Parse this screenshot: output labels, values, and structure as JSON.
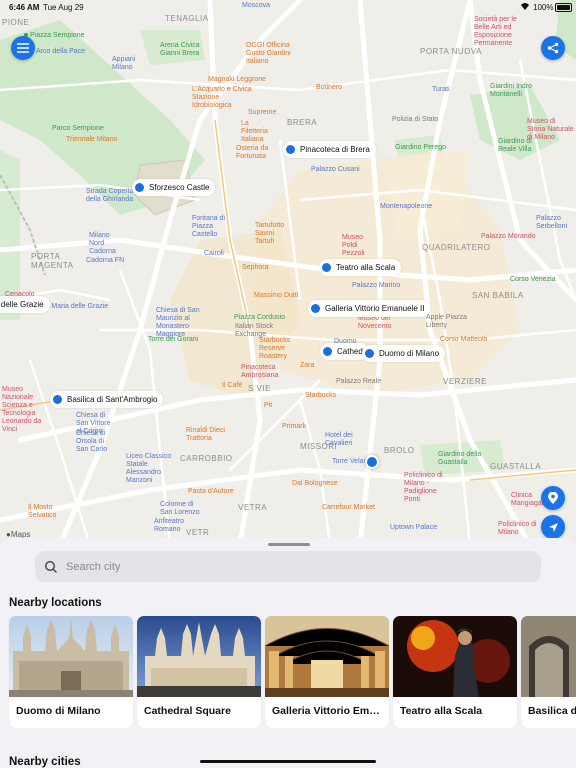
{
  "status_bar": {
    "time": "6:46 AM",
    "date": "Tue Aug 29",
    "battery": "100%"
  },
  "map": {
    "attribution": "Maps",
    "districts": [
      "PIONE",
      "TENAGLIA",
      "PORTA NUOVA",
      "BRERA",
      "PORTA MAGENTA",
      "QUADRILATERO",
      "SAN BABILA",
      "S VIE",
      "VERZIERE",
      "MISSORI",
      "CARROBBIO",
      "BROLO",
      "GUASTALLA",
      "VETRA",
      "VETR"
    ],
    "pois": [
      {
        "text": "Piazza Sempione",
        "color": "green"
      },
      {
        "text": "Arco della Pace",
        "color": "blue"
      },
      {
        "text": "Moscova",
        "color": "blue"
      },
      {
        "text": "Arena Civica Gianni Brera",
        "color": "green"
      },
      {
        "text": "Parco Sempione",
        "color": "green"
      },
      {
        "text": "OGGI Officina Gusto Giardini Italiano",
        "color": "orange"
      },
      {
        "text": "Magnaki Leggrone",
        "color": "orange"
      },
      {
        "text": "L'Acquario e Civica Stazione Idrobiologica",
        "color": "orange"
      },
      {
        "text": "Botinero",
        "color": "orange"
      },
      {
        "text": "Appiani Milano",
        "color": "blue"
      },
      {
        "text": "Triennale Milano",
        "color": "orange"
      },
      {
        "text": "Supreme",
        "color": "orange"
      },
      {
        "text": "La Filetteria Italiana",
        "color": "orange"
      },
      {
        "text": "Osteria da Fortunata",
        "color": "orange"
      },
      {
        "text": "Polizia di Stato",
        "color": "gray"
      },
      {
        "text": "Giardino Perego",
        "color": "green"
      },
      {
        "text": "Palazzo Cusani",
        "color": "blue"
      },
      {
        "text": "Turati",
        "color": "blue"
      },
      {
        "text": "Società per le Belle Arti ed Esposizione Permanente",
        "color": "red"
      },
      {
        "text": "Giardini Indro Montanelli",
        "color": "green"
      },
      {
        "text": "Museo di Storia Naturale di Milano",
        "color": "red"
      },
      {
        "text": "Giardino di Reale Villa",
        "color": "green"
      },
      {
        "text": "Strada Coperta della Ghirlanda",
        "color": "blue"
      },
      {
        "text": "Fontana di Piazza Castello",
        "color": "blue"
      },
      {
        "text": "Tartufotto Savini Tartufi",
        "color": "orange"
      },
      {
        "text": "Museo Poldi Pezzoli",
        "color": "red"
      },
      {
        "text": "Montenapoleone",
        "color": "blue"
      },
      {
        "text": "Palazzo Morando",
        "color": "red"
      },
      {
        "text": "Palazzo Serbelloni",
        "color": "blue"
      },
      {
        "text": "Milano Nord Cadorna",
        "color": "blue"
      },
      {
        "text": "Cadorna FN",
        "color": "blue"
      },
      {
        "text": "Cairoli",
        "color": "blue"
      },
      {
        "text": "Sephora",
        "color": "orange"
      },
      {
        "text": "Massimo Dutti",
        "color": "orange"
      },
      {
        "text": "Palazzo Marino",
        "color": "blue"
      },
      {
        "text": "Corso Venezia",
        "color": "green"
      },
      {
        "text": "Cenacolo",
        "color": "red"
      },
      {
        "text": "Chiesa di San Maurizio al Monastero Maggiore",
        "color": "blue"
      },
      {
        "text": "Piazza Cordusio",
        "color": "green"
      },
      {
        "text": "Italian Stock Exchange",
        "color": "gray"
      },
      {
        "text": "Museo del Novecento",
        "color": "red"
      },
      {
        "text": "Apple Piazza Liberty",
        "color": "gray"
      },
      {
        "text": "Torre dei Gorani",
        "color": "green"
      },
      {
        "text": "Starbucks Reserve Roastery",
        "color": "orange"
      },
      {
        "text": "Duomo",
        "color": "blue"
      },
      {
        "text": "Corso Matteotti",
        "color": "orange"
      },
      {
        "text": "Pinacoteca Ambrosiana",
        "color": "red"
      },
      {
        "text": "Zara",
        "color": "orange"
      },
      {
        "text": "Palazzo Reale",
        "color": "gray"
      },
      {
        "text": "Museo Nazionale Scienza e Tecnologia Leonardo da Vinci",
        "color": "red"
      },
      {
        "text": "Chiesa di San Vittore al Corpo",
        "color": "blue"
      },
      {
        "text": "Chiesa di Santa Maria delle Grazie",
        "color": "blue"
      },
      {
        "text": "Chiesa di Orsola di San Carlo",
        "color": "blue"
      },
      {
        "text": "Il Cafè",
        "color": "orange"
      },
      {
        "text": "Starbucks",
        "color": "orange"
      },
      {
        "text": "Pit",
        "color": "orange"
      },
      {
        "text": "Primark",
        "color": "orange"
      },
      {
        "text": "Rinaldi Dieci Trattoria",
        "color": "orange"
      },
      {
        "text": "Hotel dei Cavalieri",
        "color": "blue"
      },
      {
        "text": "Torre Velasca",
        "color": "blue"
      },
      {
        "text": "Liceo Classico Statale Alessandro Manzoni",
        "color": "blue"
      },
      {
        "text": "Dal Bolognese",
        "color": "orange"
      },
      {
        "text": "Giardino della Guastalla",
        "color": "green"
      },
      {
        "text": "Policlinico di Milano - Padiglione Ponti",
        "color": "red"
      },
      {
        "text": "Clinica Mangiagalli",
        "color": "red"
      },
      {
        "text": "Pasta d'Autore",
        "color": "orange"
      },
      {
        "text": "Colonne di San Lorenzo",
        "color": "blue"
      },
      {
        "text": "Carrefour Market",
        "color": "orange"
      },
      {
        "text": "Anfiteatro Romano",
        "color": "blue"
      },
      {
        "text": "Il Mosto Selvatico",
        "color": "orange"
      },
      {
        "text": "Uptown Palace",
        "color": "blue"
      },
      {
        "text": "Policlinico di Milano",
        "color": "red"
      }
    ],
    "pins": [
      "Pinacoteca di Brera",
      "Sforzesco Castle",
      "Teatro alla Scala",
      "Galleria Vittorio Emanuele II",
      "Cathed",
      "Duomo di Milano",
      "Sant Maria delle Grazie",
      "Basilica di Sant'Ambrogio"
    ],
    "buttons": {
      "menu": "menu-icon",
      "share": "share-icon",
      "pin": "location-pin-icon",
      "locate": "navigation-arrow-icon"
    }
  },
  "sheet": {
    "search_placeholder": "Search city",
    "nearby_locations_title": "Nearby locations",
    "nearby_cities_title": "Nearby cities",
    "locations": [
      {
        "name": "Duomo di Milano"
      },
      {
        "name": "Cathedral Square"
      },
      {
        "name": "Galleria Vittorio Emanuele II"
      },
      {
        "name": "Teatro alla Scala"
      },
      {
        "name": "Basilica di"
      }
    ]
  },
  "colors": {
    "accent": "#1a73e8",
    "pin": "#1a6fdc",
    "sheet_bg": "#f2f2f6",
    "map_bg": "#efeee9"
  }
}
